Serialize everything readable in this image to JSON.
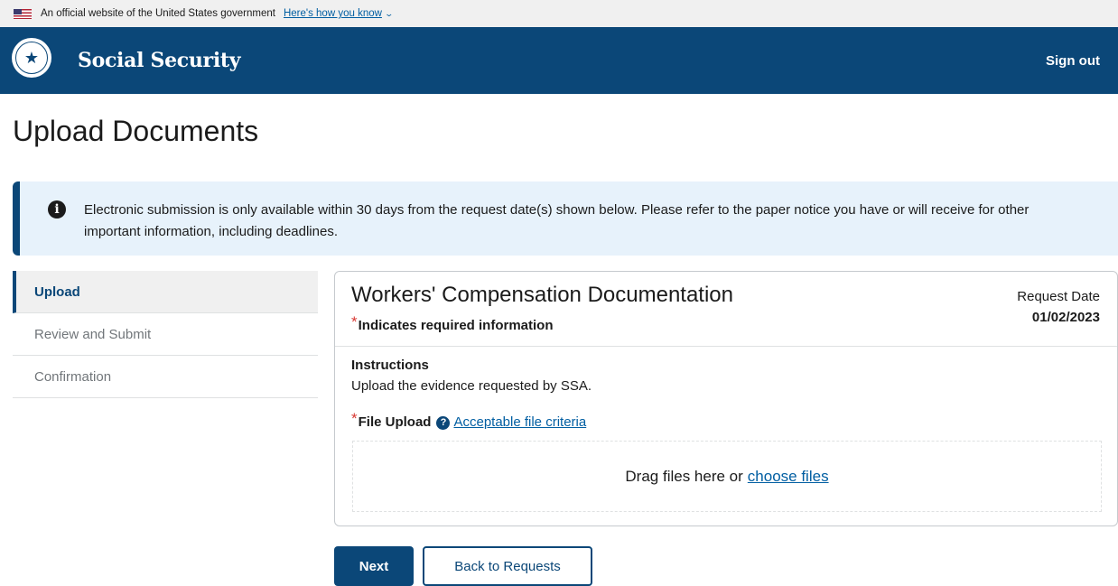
{
  "gov_banner": {
    "text": "An official website of the United States government",
    "link": "Here's how you know"
  },
  "header": {
    "brand": "Social Security",
    "sign_out": "Sign out"
  },
  "page": {
    "title": "Upload Documents"
  },
  "alert": {
    "text": "Electronic submission is only available within 30 days from the request date(s) shown below. Please refer to the paper notice you have or will receive for other important information, including deadlines."
  },
  "sidenav": {
    "items": [
      {
        "label": "Upload",
        "active": true
      },
      {
        "label": "Review and Submit",
        "active": false
      },
      {
        "label": "Confirmation",
        "active": false
      }
    ]
  },
  "card": {
    "title": "Workers' Compensation Documentation",
    "required_note": "Indicates required information",
    "request_date_label": "Request Date",
    "request_date": "01/02/2023",
    "instructions_label": "Instructions",
    "instructions_text": "Upload the evidence requested by SSA.",
    "file_upload_label": "File Upload",
    "criteria_link": "Acceptable file criteria",
    "dropzone_text": "Drag files here or",
    "dropzone_link": "choose files"
  },
  "buttons": {
    "next": "Next",
    "back": "Back to Requests"
  },
  "colors": {
    "header_bg": "#0b4778",
    "link": "#005ea2",
    "alert_bg": "#e7f2fb",
    "required": "#d83933"
  },
  "icons": {
    "flag": "us-flag-icon",
    "seal": "ssa-seal-icon",
    "info": "info-icon",
    "help": "help-icon",
    "chevron": "chevron-down-icon"
  }
}
